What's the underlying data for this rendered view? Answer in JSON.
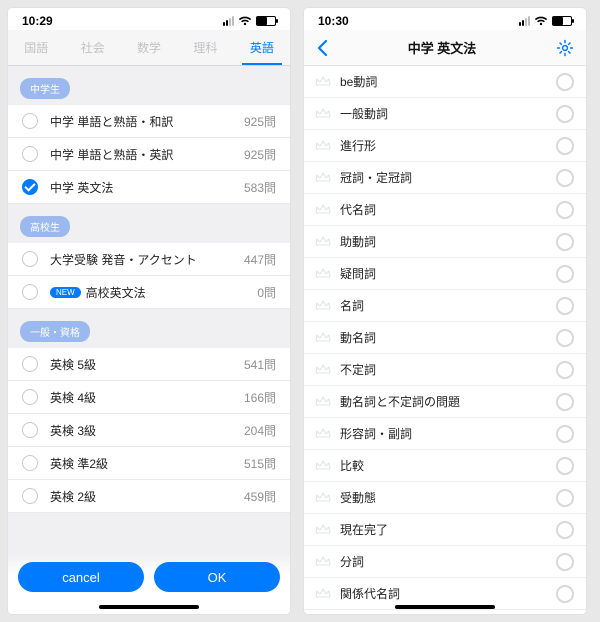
{
  "left": {
    "time": "10:29",
    "tabs": [
      "国語",
      "社会",
      "数学",
      "理科",
      "英語"
    ],
    "activeTab": 4,
    "sections": [
      {
        "chip": "中学生",
        "items": [
          {
            "label": "中学 単語と熟語・和訳",
            "count": "925問",
            "selected": false
          },
          {
            "label": "中学 単語と熟語・英訳",
            "count": "925問",
            "selected": false
          },
          {
            "label": "中学 英文法",
            "count": "583問",
            "selected": true
          }
        ]
      },
      {
        "chip": "高校生",
        "items": [
          {
            "label": "大学受験 発音・アクセント",
            "count": "447問",
            "selected": false
          },
          {
            "label": "高校英文法",
            "count": "0問",
            "selected": false,
            "new": true
          }
        ]
      },
      {
        "chip": "一般・資格",
        "items": [
          {
            "label": "英検 5級",
            "count": "541問",
            "selected": false
          },
          {
            "label": "英検 4級",
            "count": "166問",
            "selected": false
          },
          {
            "label": "英検 3級",
            "count": "204問",
            "selected": false
          },
          {
            "label": "英検 準2級",
            "count": "515問",
            "selected": false
          },
          {
            "label": "英検 2級",
            "count": "459問",
            "selected": false
          }
        ]
      }
    ],
    "footer": {
      "cancel": "cancel",
      "ok": "OK"
    }
  },
  "right": {
    "time": "10:30",
    "title": "中学 英文法",
    "rows": [
      "be動詞",
      "一般動詞",
      "進行形",
      "冠詞・定冠詞",
      "代名詞",
      "助動詞",
      "疑問詞",
      "名詞",
      "動名詞",
      "不定詞",
      "動名詞と不定詞の問題",
      "形容詞・副詞",
      "比較",
      "受動態",
      "現在完了",
      "分詞",
      "関係代名詞"
    ]
  }
}
